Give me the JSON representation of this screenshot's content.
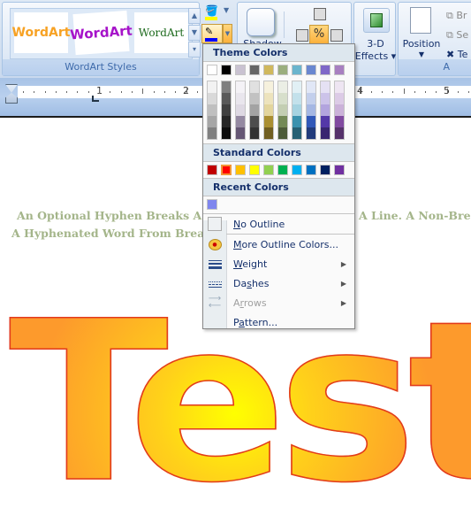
{
  "ribbon": {
    "wordart_styles": {
      "label": "WordArt Styles",
      "items": [
        "WordArt",
        "WordArt",
        "WordArt"
      ]
    },
    "shadow_label": "Shadow",
    "three_d": {
      "line1": "3-D",
      "line2": "Effects"
    },
    "arrange": {
      "position_label": "Position",
      "bring_label": "Br",
      "send_label": "Se",
      "text_wrap_label": "Te",
      "group_label": "A"
    },
    "fill_color": "#ffff00",
    "outline_color": "#0000ff"
  },
  "ruler": {
    "numbers": [
      "1",
      "2",
      "4",
      "5"
    ]
  },
  "document": {
    "line1_left": "An Optional Hyphen Breaks A W",
    "line1_right": "A Line. A Non-Break",
    "line2_left": "A Hyphenated  Word From Breakin",
    "wordart_text": "Test"
  },
  "outline_menu": {
    "theme_header": "Theme Colors",
    "theme_colors": [
      "#ffffff",
      "#000000",
      "#c9c2d1",
      "#666666",
      "#d0b85d",
      "#9bae7e",
      "#6bb5cd",
      "#6a87d0",
      "#7f68c8",
      "#a87fc0"
    ],
    "theme_shades": [
      [
        "#f2f2f2",
        "#d9d9d9",
        "#bfbfbf",
        "#a6a6a6",
        "#808080"
      ],
      [
        "#7f7f7f",
        "#595959",
        "#404040",
        "#262626",
        "#0d0d0d"
      ],
      [
        "#f4f2f6",
        "#e9e6ed",
        "#ded9e3",
        "#958aa2",
        "#655774"
      ],
      [
        "#e0e0e0",
        "#c2c2c2",
        "#a3a3a3",
        "#4d4d4d",
        "#333333"
      ],
      [
        "#f6f1dd",
        "#ede3bd",
        "#e3d59d",
        "#aa8f32",
        "#715f21"
      ],
      [
        "#ebeee5",
        "#d7dfcb",
        "#c3ceb2",
        "#748a56",
        "#4d5c39"
      ],
      [
        "#e1f0f5",
        "#c3e1eb",
        "#a6d3e1",
        "#3b92ae",
        "#276174"
      ],
      [
        "#e1e7f6",
        "#c3cfec",
        "#a5b7e3",
        "#3158b8",
        "#213b7b"
      ],
      [
        "#e5e1f4",
        "#ccc3e9",
        "#b2a4de",
        "#5438a8",
        "#382570"
      ],
      [
        "#eee5f2",
        "#dccbe6",
        "#cbb2d9",
        "#814ba0",
        "#56326b"
      ]
    ],
    "standard_header": "Standard Colors",
    "standard_colors": [
      "#c00000",
      "#ff0000",
      "#ffc000",
      "#ffff00",
      "#92d050",
      "#00b050",
      "#00b0f0",
      "#0070c0",
      "#002060",
      "#7030a0"
    ],
    "selected_standard": 1,
    "recent_header": "Recent Colors",
    "recent_colors": [
      "#7f86ee"
    ],
    "items": [
      {
        "key": "N",
        "label_rest": "o Outline",
        "icon": "no-outline-icon",
        "submenu": false,
        "disabled": false
      },
      {
        "key": "M",
        "label_rest": "ore Outline Colors...",
        "icon": "palette-icon",
        "submenu": false,
        "disabled": false
      },
      {
        "key": "W",
        "label_rest": "eight",
        "icon": "weight-icon",
        "submenu": true,
        "disabled": false
      },
      {
        "pre": "Da",
        "key": "s",
        "label_rest": "hes",
        "icon": "dashes-icon",
        "submenu": true,
        "disabled": false
      },
      {
        "pre": "A",
        "key": "r",
        "label_rest": "rows",
        "icon": "arrows-icon",
        "submenu": true,
        "disabled": true
      },
      {
        "pre": "P",
        "key": "a",
        "label_rest": "ttern...",
        "icon": "pattern-icon",
        "submenu": false,
        "disabled": false
      }
    ]
  }
}
